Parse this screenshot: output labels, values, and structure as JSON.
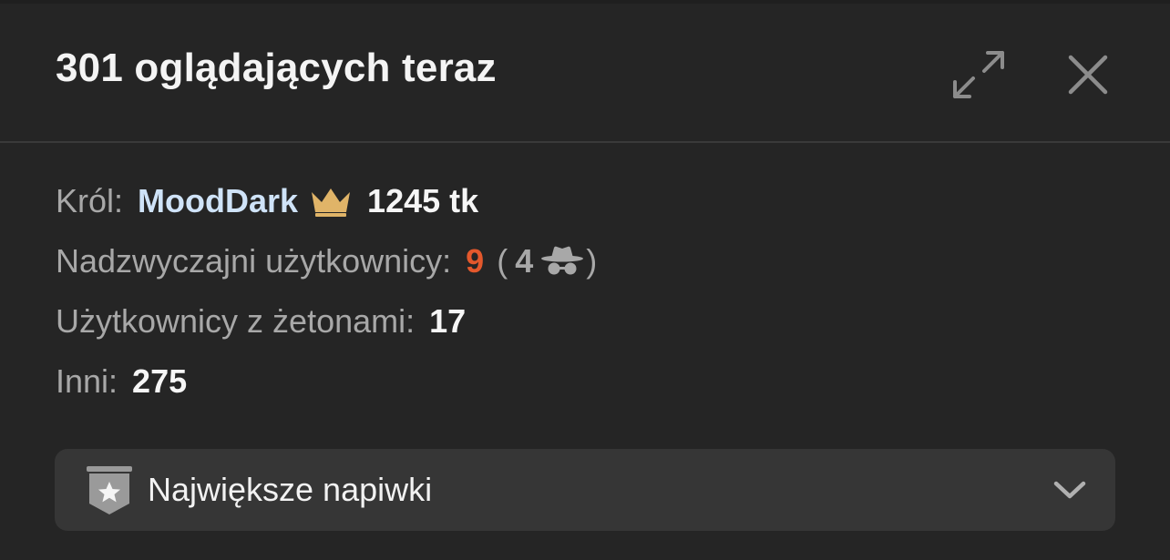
{
  "header": {
    "title": "301 oglądających teraz",
    "expand_icon": "expand-icon",
    "close_icon": "close-icon"
  },
  "stats": {
    "king": {
      "label": "Król:",
      "name": "MoodDark",
      "crown_icon": "crown-icon",
      "tokens": "1245 tk"
    },
    "special_users": {
      "label": "Nadzwyczajni użytkownicy:",
      "count": "9",
      "open_paren": "(",
      "anonymous_count": "4",
      "anonymous_icon": "incognito-icon",
      "close_paren": ")"
    },
    "token_users": {
      "label": "Użytkownicy z żetonami:",
      "count": "17"
    },
    "others": {
      "label": "Inni:",
      "count": "275"
    }
  },
  "dropdown": {
    "label": "Największe napiwki",
    "badge_icon": "star-shield-icon",
    "chevron_icon": "chevron-down-icon"
  },
  "colors": {
    "background": "#252525",
    "king_name": "#cfe3f8",
    "crown": "#e0b468",
    "special_count": "#e4582c",
    "muted_text": "#a8a8a8",
    "dropdown_bg": "#363636"
  }
}
